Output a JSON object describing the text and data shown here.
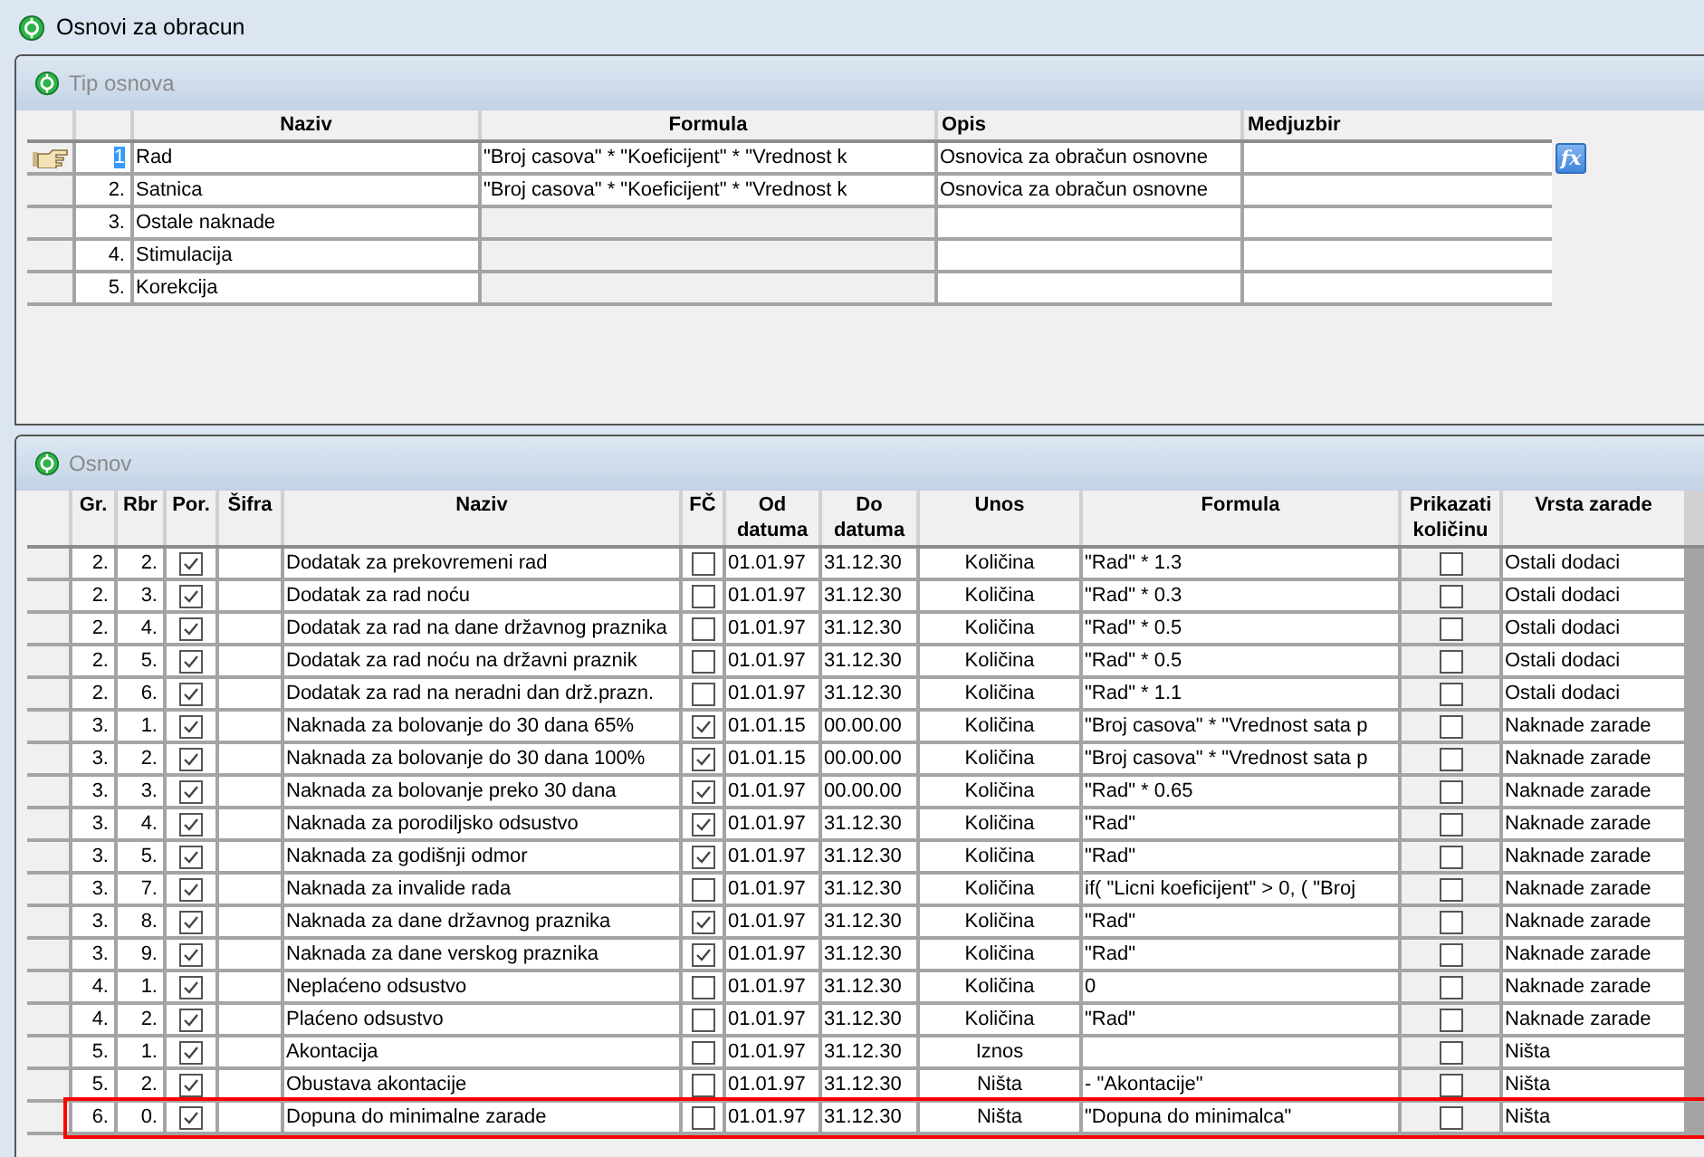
{
  "window": {
    "title": "Osnovi za obracun"
  },
  "tip_osnova": {
    "title": "Tip osnova",
    "columns": [
      "Naziv",
      "Formula",
      "Opis",
      "Medjuzbir"
    ],
    "formula_button": "fx",
    "rows": [
      {
        "rbr": "1",
        "naziv": "Rad",
        "formula": "\"Broj casova\" *  \"Koeficijent\" *  \"Vrednost k",
        "opis": "Osnovica za obračun osnovne",
        "selected": true,
        "formula_readonly": false
      },
      {
        "rbr": "2.",
        "naziv": "Satnica",
        "formula": "\"Broj casova\" *  \"Koeficijent\" *  \"Vrednost k",
        "opis": "Osnovica za obračun osnovne",
        "selected": false,
        "formula_readonly": false
      },
      {
        "rbr": "3.",
        "naziv": "Ostale naknade",
        "selected": false,
        "formula_readonly": true
      },
      {
        "rbr": "4.",
        "naziv": "Stimulacija",
        "selected": false,
        "formula_readonly": true
      },
      {
        "rbr": "5.",
        "naziv": "Korekcija",
        "selected": false,
        "formula_readonly": true
      }
    ]
  },
  "osnov": {
    "title": "Osnov",
    "columns": [
      "Gr.",
      "Rbr",
      "Por.",
      "Šifra",
      "Naziv",
      "FČ",
      "Od datuma",
      "Do datuma",
      "Unos",
      "Formula",
      "Prikazati količinu",
      "Vrsta zarade"
    ],
    "rows": [
      {
        "gr": "2.",
        "rbr": "2.",
        "por": true,
        "naziv": "Dodatak za prekovremeni rad",
        "fc": false,
        "od": "01.01.97",
        "do": "31.12.30",
        "unos": "Količina",
        "formula": "\"Rad\" * 1.3",
        "prikazati": false,
        "vrsta": "Ostali dodaci",
        "highlighted": false
      },
      {
        "gr": "2.",
        "rbr": "3.",
        "por": true,
        "naziv": "Dodatak za rad noću",
        "fc": false,
        "od": "01.01.97",
        "do": "31.12.30",
        "unos": "Količina",
        "formula": "\"Rad\" * 0.3",
        "prikazati": false,
        "vrsta": "Ostali dodaci",
        "highlighted": false
      },
      {
        "gr": "2.",
        "rbr": "4.",
        "por": true,
        "naziv": "Dodatak za rad na dane državnog praznika",
        "fc": false,
        "od": "01.01.97",
        "do": "31.12.30",
        "unos": "Količina",
        "formula": "\"Rad\" * 0.5",
        "prikazati": false,
        "vrsta": "Ostali dodaci",
        "highlighted": false
      },
      {
        "gr": "2.",
        "rbr": "5.",
        "por": true,
        "naziv": "Dodatak za rad noću na državni praznik",
        "fc": false,
        "od": "01.01.97",
        "do": "31.12.30",
        "unos": "Količina",
        "formula": "\"Rad\" * 0.5",
        "prikazati": false,
        "vrsta": "Ostali dodaci",
        "highlighted": false
      },
      {
        "gr": "2.",
        "rbr": "6.",
        "por": true,
        "naziv": "Dodatak za rad na neradni dan drž.prazn.",
        "fc": false,
        "od": "01.01.97",
        "do": "31.12.30",
        "unos": "Količina",
        "formula": "\"Rad\" * 1.1",
        "prikazati": false,
        "vrsta": "Ostali dodaci",
        "highlighted": false
      },
      {
        "gr": "3.",
        "rbr": "1.",
        "por": true,
        "naziv": "Naknada za bolovanje do 30 dana 65%",
        "fc": true,
        "od": "01.01.15",
        "do": "00.00.00",
        "unos": "Količina",
        "formula": "\"Broj casova\" * \"Vrednost sata p",
        "prikazati": false,
        "vrsta": "Naknade zarade",
        "highlighted": false
      },
      {
        "gr": "3.",
        "rbr": "2.",
        "por": true,
        "naziv": "Naknada za bolovanje do 30 dana 100%",
        "fc": true,
        "od": "01.01.15",
        "do": "00.00.00",
        "unos": "Količina",
        "formula": "\"Broj casova\" * \"Vrednost sata p",
        "prikazati": false,
        "vrsta": "Naknade zarade",
        "highlighted": false
      },
      {
        "gr": "3.",
        "rbr": "3.",
        "por": true,
        "naziv": "Naknada za bolovanje preko 30 dana",
        "fc": true,
        "od": "01.01.97",
        "do": "00.00.00",
        "unos": "Količina",
        "formula": "\"Rad\" * 0.65",
        "prikazati": false,
        "vrsta": "Naknade zarade",
        "highlighted": false
      },
      {
        "gr": "3.",
        "rbr": "4.",
        "por": true,
        "naziv": "Naknada za porodiljsko odsustvo",
        "fc": true,
        "od": "01.01.97",
        "do": "31.12.30",
        "unos": "Količina",
        "formula": "\"Rad\"",
        "prikazati": false,
        "vrsta": "Naknade zarade",
        "highlighted": false
      },
      {
        "gr": "3.",
        "rbr": "5.",
        "por": true,
        "naziv": "Naknada za godišnji odmor",
        "fc": true,
        "od": "01.01.97",
        "do": "31.12.30",
        "unos": "Količina",
        "formula": "\"Rad\"",
        "prikazati": false,
        "vrsta": "Naknade zarade",
        "highlighted": false
      },
      {
        "gr": "3.",
        "rbr": "7.",
        "por": true,
        "naziv": "Naknada za invalide rada",
        "fc": false,
        "od": "01.01.97",
        "do": "31.12.30",
        "unos": "Količina",
        "formula": "if( \"Licni koeficijent\"  > 0, (  \"Broj",
        "prikazati": false,
        "vrsta": "Naknade zarade",
        "highlighted": false
      },
      {
        "gr": "3.",
        "rbr": "8.",
        "por": true,
        "naziv": "Naknada za dane državnog praznika",
        "fc": true,
        "od": "01.01.97",
        "do": "31.12.30",
        "unos": "Količina",
        "formula": "\"Rad\"",
        "prikazati": false,
        "vrsta": "Naknade zarade",
        "highlighted": false
      },
      {
        "gr": "3.",
        "rbr": "9.",
        "por": true,
        "naziv": "Naknada za dane verskog praznika",
        "fc": true,
        "od": "01.01.97",
        "do": "31.12.30",
        "unos": "Količina",
        "formula": "\"Rad\"",
        "prikazati": false,
        "vrsta": "Naknade zarade",
        "highlighted": false
      },
      {
        "gr": "4.",
        "rbr": "1.",
        "por": true,
        "naziv": "Neplaćeno odsustvo",
        "fc": false,
        "od": "01.01.97",
        "do": "31.12.30",
        "unos": "Količina",
        "formula": "0",
        "prikazati": false,
        "vrsta": "Naknade zarade",
        "highlighted": false
      },
      {
        "gr": "4.",
        "rbr": "2.",
        "por": true,
        "naziv": "Plaćeno odsustvo",
        "fc": false,
        "od": "01.01.97",
        "do": "31.12.30",
        "unos": "Količina",
        "formula": "\"Rad\"",
        "prikazati": false,
        "vrsta": "Naknade zarade",
        "highlighted": false
      },
      {
        "gr": "5.",
        "rbr": "1.",
        "por": true,
        "naziv": "Akontacija",
        "fc": false,
        "od": "01.01.97",
        "do": "31.12.30",
        "unos": "Iznos",
        "prikazati": false,
        "vrsta": "Ništa",
        "highlighted": false
      },
      {
        "gr": "5.",
        "rbr": "2.",
        "por": true,
        "naziv": "Obustava akontacije",
        "fc": false,
        "od": "01.01.97",
        "do": "31.12.30",
        "unos": "Ništa",
        "formula": " - \"Akontacije\"",
        "prikazati": false,
        "vrsta": "Ništa",
        "highlighted": false
      },
      {
        "gr": "6.",
        "rbr": "0.",
        "por": true,
        "naziv": "Dopuna do minimalne zarade",
        "fc": false,
        "od": "01.01.97",
        "do": "31.12.30",
        "unos": "Ništa",
        "formula": " \"Dopuna do minimalca\"",
        "prikazati": false,
        "vrsta": "Ništa",
        "highlighted": true
      }
    ]
  }
}
